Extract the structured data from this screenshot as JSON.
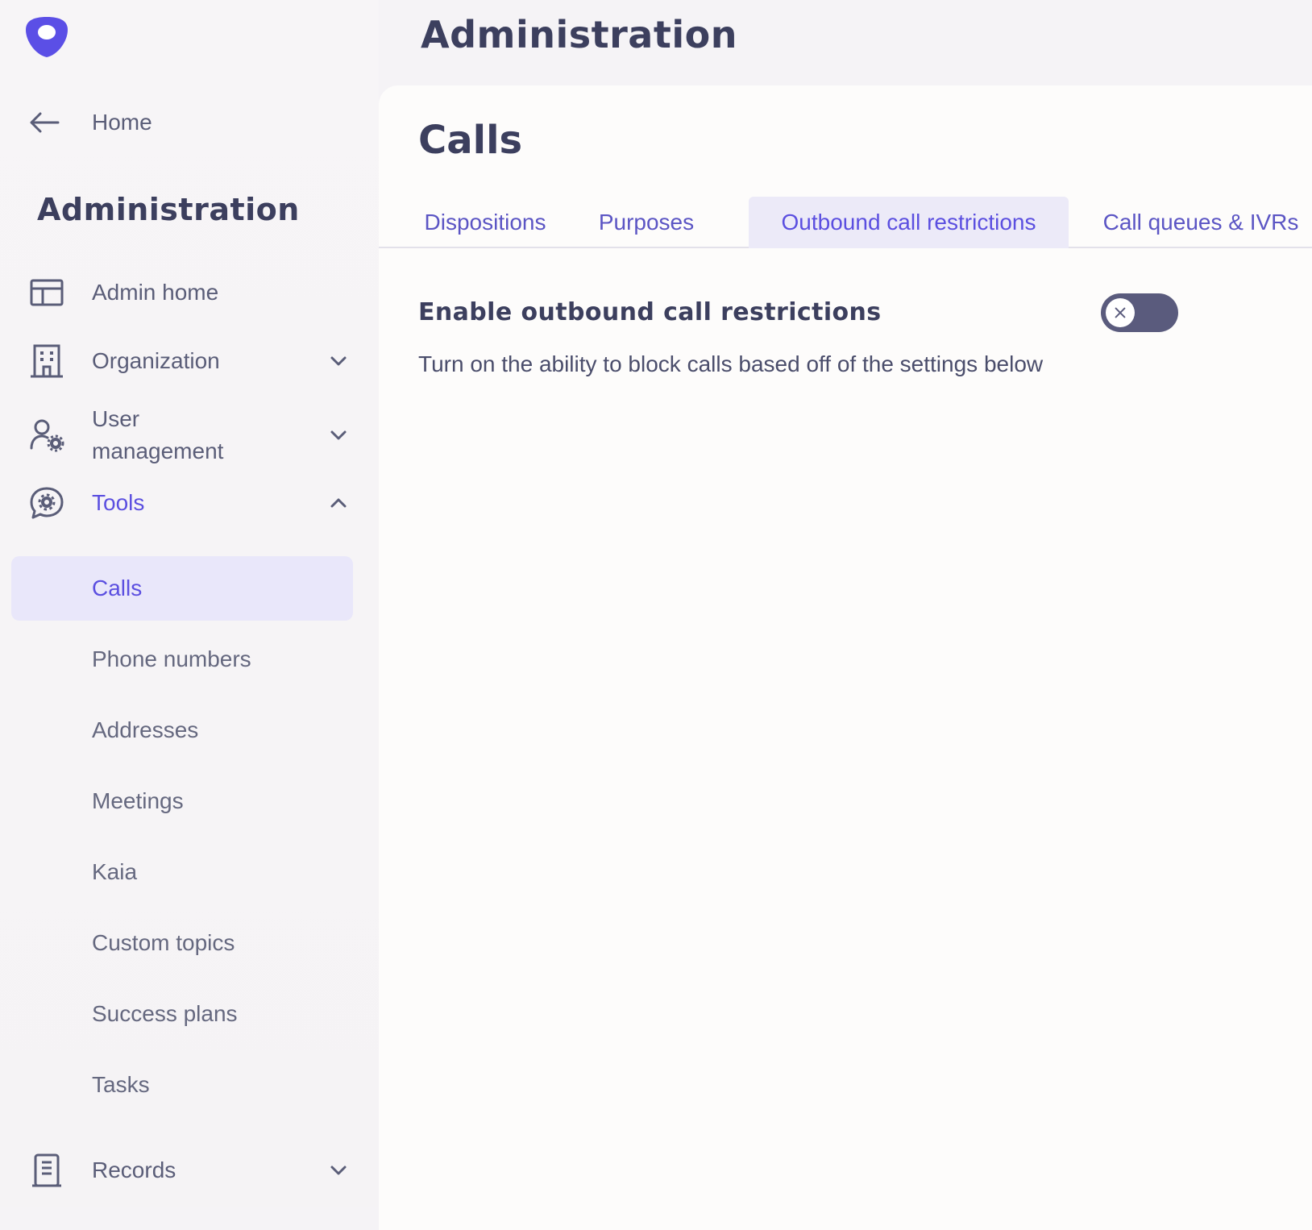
{
  "app": {
    "header_title": "Administration"
  },
  "sidebar": {
    "home_label": "Home",
    "section_title": "Administration",
    "items": [
      {
        "label": "Admin home",
        "icon": "layout-icon"
      },
      {
        "label": "Organization",
        "icon": "building-icon",
        "expandable": true,
        "expanded": false
      },
      {
        "label": "User management",
        "icon": "user-gear-icon",
        "expandable": true,
        "expanded": false
      },
      {
        "label": "Tools",
        "icon": "chat-gear-icon",
        "expandable": true,
        "expanded": true,
        "active": true
      },
      {
        "label": "Records",
        "icon": "records-icon",
        "expandable": true,
        "expanded": false
      }
    ],
    "user_management_line1": "User",
    "user_management_line2": "management",
    "tools_sub_items": [
      {
        "label": "Calls",
        "selected": true
      },
      {
        "label": "Phone numbers"
      },
      {
        "label": "Addresses"
      },
      {
        "label": "Meetings"
      },
      {
        "label": "Kaia"
      },
      {
        "label": "Custom topics"
      },
      {
        "label": "Success plans"
      },
      {
        "label": "Tasks"
      }
    ]
  },
  "main": {
    "title": "Calls",
    "tabs": [
      {
        "label": "Dispositions"
      },
      {
        "label": "Purposes"
      },
      {
        "label": "Outbound call restrictions",
        "active": true
      },
      {
        "label": "Call queues & IVRs"
      }
    ],
    "setting": {
      "title": "Enable outbound call restrictions",
      "description": "Turn on the ability to block calls based off of the settings below",
      "toggle_on": false
    }
  },
  "colors": {
    "accent": "#5b4fe0",
    "logo": "#5b4fe6",
    "toggle_off": "#5a5b7d",
    "selected_bg": "#e9e7fa",
    "text_dark": "#3c3f5e"
  }
}
